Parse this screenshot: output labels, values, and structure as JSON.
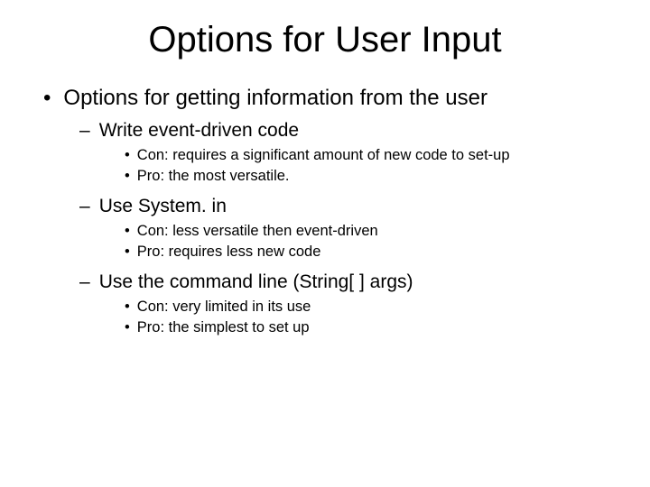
{
  "title": "Options for User Input",
  "main": "Options for getting information from the user",
  "opts": [
    {
      "name": "Write event-driven code",
      "con": "Con: requires a significant amount of new code to set-up",
      "pro": "Pro: the most versatile."
    },
    {
      "name": "Use System. in",
      "con": "Con: less versatile then event-driven",
      "pro": "Pro: requires less new code"
    },
    {
      "name": "Use the command line (String[ ] args)",
      "con": "Con: very limited in its use",
      "pro": "Pro: the simplest to set up"
    }
  ]
}
